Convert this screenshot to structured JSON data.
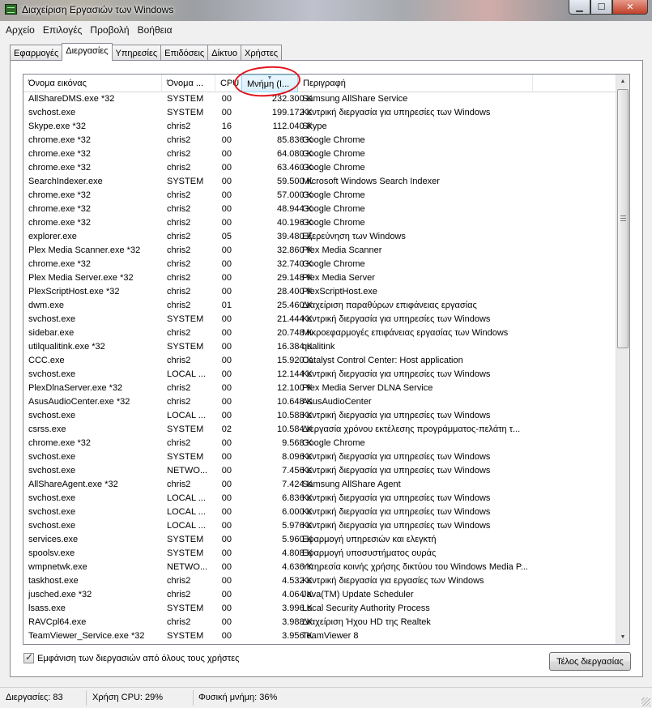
{
  "window": {
    "title": "Διαχείριση Εργασιών των Windows"
  },
  "menu": [
    "Αρχείο",
    "Επιλογές",
    "Προβολή",
    "Βοήθεια"
  ],
  "tabs": [
    {
      "label": "Εφαρμογές",
      "active": false
    },
    {
      "label": "Διεργασίες",
      "active": true
    },
    {
      "label": "Υπηρεσίες",
      "active": false
    },
    {
      "label": "Επιδόσεις",
      "active": false
    },
    {
      "label": "Δίκτυο",
      "active": false
    },
    {
      "label": "Χρήστες",
      "active": false
    }
  ],
  "columns": {
    "name": "Όνομα εικόνας",
    "user": "Όνομα ...",
    "cpu": "CPU",
    "mem": "Μνήμη (Ι...",
    "desc": "Περιγραφή"
  },
  "processes": [
    {
      "name": "AllShareDMS.exe *32",
      "user": "SYSTEM",
      "cpu": "00",
      "mem": "232.300 K",
      "desc": "Samsung AllShare Service"
    },
    {
      "name": "svchost.exe",
      "user": "SYSTEM",
      "cpu": "00",
      "mem": "199.172 K",
      "desc": "Κεντρική διεργασία για υπηρεσίες των Windows"
    },
    {
      "name": "Skype.exe *32",
      "user": "chris2",
      "cpu": "16",
      "mem": "112.040 K",
      "desc": "Skype"
    },
    {
      "name": "chrome.exe *32",
      "user": "chris2",
      "cpu": "00",
      "mem": "85.836 K",
      "desc": "Google Chrome"
    },
    {
      "name": "chrome.exe *32",
      "user": "chris2",
      "cpu": "00",
      "mem": "64.080 K",
      "desc": "Google Chrome"
    },
    {
      "name": "chrome.exe *32",
      "user": "chris2",
      "cpu": "00",
      "mem": "63.460 K",
      "desc": "Google Chrome"
    },
    {
      "name": "SearchIndexer.exe",
      "user": "SYSTEM",
      "cpu": "00",
      "mem": "59.500 K",
      "desc": "Microsoft Windows Search Indexer"
    },
    {
      "name": "chrome.exe *32",
      "user": "chris2",
      "cpu": "00",
      "mem": "57.000 K",
      "desc": "Google Chrome"
    },
    {
      "name": "chrome.exe *32",
      "user": "chris2",
      "cpu": "00",
      "mem": "48.944 K",
      "desc": "Google Chrome"
    },
    {
      "name": "chrome.exe *32",
      "user": "chris2",
      "cpu": "00",
      "mem": "40.196 K",
      "desc": "Google Chrome"
    },
    {
      "name": "explorer.exe",
      "user": "chris2",
      "cpu": "05",
      "mem": "39.480 K",
      "desc": "Εξερεύνηση των Windows"
    },
    {
      "name": "Plex Media Scanner.exe *32",
      "user": "chris2",
      "cpu": "00",
      "mem": "32.860 K",
      "desc": "Plex Media Scanner"
    },
    {
      "name": "chrome.exe *32",
      "user": "chris2",
      "cpu": "00",
      "mem": "32.740 K",
      "desc": "Google Chrome"
    },
    {
      "name": "Plex Media Server.exe *32",
      "user": "chris2",
      "cpu": "00",
      "mem": "29.148 K",
      "desc": "Plex Media Server"
    },
    {
      "name": "PlexScriptHost.exe *32",
      "user": "chris2",
      "cpu": "00",
      "mem": "28.400 K",
      "desc": "PlexScriptHost.exe"
    },
    {
      "name": "dwm.exe",
      "user": "chris2",
      "cpu": "01",
      "mem": "25.460 K",
      "desc": "Διαχείριση παραθύρων επιφάνειας εργασίας"
    },
    {
      "name": "svchost.exe",
      "user": "SYSTEM",
      "cpu": "00",
      "mem": "21.444 K",
      "desc": "Κεντρική διεργασία για υπηρεσίες των Windows"
    },
    {
      "name": "sidebar.exe",
      "user": "chris2",
      "cpu": "00",
      "mem": "20.748 K",
      "desc": "Μικροεφαρμογές επιφάνειας εργασίας των Windows"
    },
    {
      "name": "utilqualitink.exe *32",
      "user": "SYSTEM",
      "cpu": "00",
      "mem": "16.384 K",
      "desc": "qualitink"
    },
    {
      "name": "CCC.exe",
      "user": "chris2",
      "cpu": "00",
      "mem": "15.920 K",
      "desc": "Catalyst Control Center: Host application"
    },
    {
      "name": "svchost.exe",
      "user": "LOCAL ...",
      "cpu": "00",
      "mem": "12.144 K",
      "desc": "Κεντρική διεργασία για υπηρεσίες των Windows"
    },
    {
      "name": "PlexDlnaServer.exe *32",
      "user": "chris2",
      "cpu": "00",
      "mem": "12.100 K",
      "desc": "Plex Media Server DLNA Service"
    },
    {
      "name": "AsusAudioCenter.exe *32",
      "user": "chris2",
      "cpu": "00",
      "mem": "10.648 K",
      "desc": "AsusAudioCenter"
    },
    {
      "name": "svchost.exe",
      "user": "LOCAL ...",
      "cpu": "00",
      "mem": "10.588 K",
      "desc": "Κεντρική διεργασία για υπηρεσίες των Windows"
    },
    {
      "name": "csrss.exe",
      "user": "SYSTEM",
      "cpu": "02",
      "mem": "10.584 K",
      "desc": "Διεργασία χρόνου εκτέλεσης προγράμματος-πελάτη τ..."
    },
    {
      "name": "chrome.exe *32",
      "user": "chris2",
      "cpu": "00",
      "mem": "9.568 K",
      "desc": "Google Chrome"
    },
    {
      "name": "svchost.exe",
      "user": "SYSTEM",
      "cpu": "00",
      "mem": "8.096 K",
      "desc": "Κεντρική διεργασία για υπηρεσίες των Windows"
    },
    {
      "name": "svchost.exe",
      "user": "NETWO...",
      "cpu": "00",
      "mem": "7.456 K",
      "desc": "Κεντρική διεργασία για υπηρεσίες των Windows"
    },
    {
      "name": "AllShareAgent.exe *32",
      "user": "chris2",
      "cpu": "00",
      "mem": "7.424 K",
      "desc": "Samsung AllShare Agent"
    },
    {
      "name": "svchost.exe",
      "user": "LOCAL ...",
      "cpu": "00",
      "mem": "6.836 K",
      "desc": "Κεντρική διεργασία για υπηρεσίες των Windows"
    },
    {
      "name": "svchost.exe",
      "user": "LOCAL ...",
      "cpu": "00",
      "mem": "6.000 K",
      "desc": "Κεντρική διεργασία για υπηρεσίες των Windows"
    },
    {
      "name": "svchost.exe",
      "user": "LOCAL ...",
      "cpu": "00",
      "mem": "5.976 K",
      "desc": "Κεντρική διεργασία για υπηρεσίες των Windows"
    },
    {
      "name": "services.exe",
      "user": "SYSTEM",
      "cpu": "00",
      "mem": "5.960 K",
      "desc": "Εφαρμογή υπηρεσιών και ελεγκτή"
    },
    {
      "name": "spoolsv.exe",
      "user": "SYSTEM",
      "cpu": "00",
      "mem": "4.808 K",
      "desc": "Εφαρμογή υποσυστήματος ουράς"
    },
    {
      "name": "wmpnetwk.exe",
      "user": "NETWO...",
      "cpu": "00",
      "mem": "4.636 K",
      "desc": "Υπηρεσία κοινής χρήσης δικτύου του Windows Media P..."
    },
    {
      "name": "taskhost.exe",
      "user": "chris2",
      "cpu": "00",
      "mem": "4.532 K",
      "desc": "Κεντρική διεργασία για εργασίες των Windows"
    },
    {
      "name": "jusched.exe *32",
      "user": "chris2",
      "cpu": "00",
      "mem": "4.064 K",
      "desc": "Java(TM) Update Scheduler"
    },
    {
      "name": "lsass.exe",
      "user": "SYSTEM",
      "cpu": "00",
      "mem": "3.996 K",
      "desc": "Local Security Authority Process"
    },
    {
      "name": "RAVCpl64.exe",
      "user": "chris2",
      "cpu": "00",
      "mem": "3.988 K",
      "desc": "Διαχείριση Ήχου HD της Realtek"
    },
    {
      "name": "TeamViewer_Service.exe *32",
      "user": "SYSTEM",
      "cpu": "00",
      "mem": "3.956 K",
      "desc": "TeamViewer 8"
    }
  ],
  "show_all_label": "Εμφάνιση των διεργασιών από όλους τους χρήστες",
  "show_all_checked": true,
  "end_process_label": "Τέλος διεργασίας",
  "status": {
    "processes": "Διεργασίες: 83",
    "cpu": "Χρήση CPU: 29%",
    "memory": "Φυσική μνήμη: 36%"
  },
  "colors": {
    "annotation": "#e2141c",
    "sorted_header": "#d9f0fc"
  }
}
